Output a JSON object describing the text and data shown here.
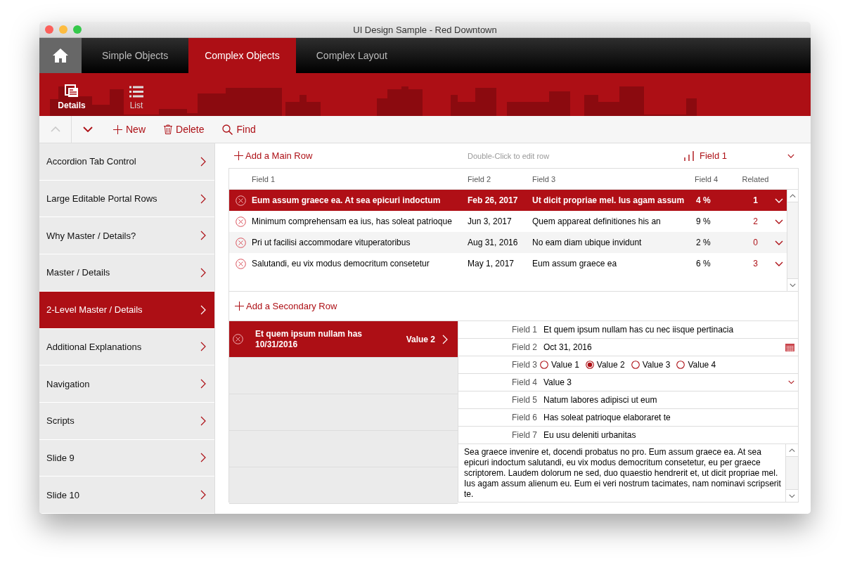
{
  "window": {
    "title": "UI Design Sample - Red Downtown"
  },
  "top_tabs": [
    {
      "label": "Simple Objects",
      "selected": false
    },
    {
      "label": "Complex Objects",
      "selected": true
    },
    {
      "label": "Complex Layout",
      "selected": false
    }
  ],
  "layouts": [
    {
      "label": "Details",
      "selected": true
    },
    {
      "label": "List",
      "selected": false
    }
  ],
  "toolbar": [
    {
      "kind": "up",
      "disabled": true
    },
    {
      "kind": "down",
      "disabled": false
    },
    {
      "kind": "new",
      "label": "New"
    },
    {
      "kind": "delete",
      "label": "Delete"
    },
    {
      "kind": "find",
      "label": "Find"
    }
  ],
  "sidebar": {
    "items": [
      {
        "label": "Accordion Tab Control",
        "selected": false
      },
      {
        "label": "Large Editable Portal Rows",
        "selected": false
      },
      {
        "label": "Why Master / Details?",
        "selected": false
      },
      {
        "label": "Master / Details",
        "selected": false
      },
      {
        "label": "2-Level Master / Details",
        "selected": true
      },
      {
        "label": "Additional Explanations",
        "selected": false
      },
      {
        "label": "Navigation",
        "selected": false
      },
      {
        "label": "Scripts",
        "selected": false
      },
      {
        "label": "Slide 9",
        "selected": false
      },
      {
        "label": "Slide 10",
        "selected": false
      }
    ]
  },
  "main_portal": {
    "add_label": "Add a Main Row",
    "hint": "Double-Click to edit row",
    "sort_field": "Field 1",
    "columns": [
      "Field 1",
      "Field 2",
      "Field 3",
      "Field 4",
      "Related"
    ],
    "rows": [
      {
        "field_1": "Eum assum graece ea. At sea epicuri indoctum",
        "field_2": "Feb 26, 2017",
        "field_3": "Ut dicit propriae mel. Ius agam assum",
        "field_4": "4 %",
        "related": "1",
        "selected": true
      },
      {
        "field_1": "Minimum comprehensam ea ius, has soleat patrioque",
        "field_2": "Jun 3, 2017",
        "field_3": "Quem appareat definitiones his an",
        "field_4": "9 %",
        "related": "2",
        "selected": false
      },
      {
        "field_1": "Pri ut facilisi accommodare vituperatoribus",
        "field_2": "Aug 31, 2016",
        "field_3": "No eam diam ubique invidunt",
        "field_4": "2 %",
        "related": "0",
        "selected": false
      },
      {
        "field_1": "Salutandi, eu vix modus democritum consetetur",
        "field_2": "May 1, 2017",
        "field_3": "Eum assum graece ea",
        "field_4": "6 %",
        "related": "3",
        "selected": false
      }
    ]
  },
  "secondary_portal": {
    "add_label": "Add a Secondary Row",
    "rows": [
      {
        "title": "Et quem ipsum nullam has",
        "date": "10/31/2016",
        "value": "Value 2",
        "selected": true
      }
    ]
  },
  "details": {
    "fields": [
      {
        "label": "Field 1",
        "kind": "text",
        "value": "Et quem ipsum nullam has cu nec iisque pertinacia"
      },
      {
        "label": "Field 2",
        "kind": "date",
        "value": "Oct 31, 2016"
      },
      {
        "label": "Field 3",
        "kind": "radio",
        "options": [
          {
            "label": "Value 1",
            "selected": false
          },
          {
            "label": "Value 2",
            "selected": true
          },
          {
            "label": "Value 3",
            "selected": false
          },
          {
            "label": "Value 4",
            "selected": false
          }
        ]
      },
      {
        "label": "Field 4",
        "kind": "dropdown",
        "value": "Value 3"
      },
      {
        "label": "Field 5",
        "kind": "text",
        "value": "Natum labores adipisci ut eum"
      },
      {
        "label": "Field 6",
        "kind": "text",
        "value": "Has soleat patrioque elaboraret te"
      },
      {
        "label": "Field 7",
        "kind": "text",
        "value": "Eu usu deleniti urbanitas"
      }
    ],
    "notes": "Sea graece invenire et, docendi probatus no pro. Eum assum graece ea. At sea epicuri indoctum salutandi, eu vix modus democritum consetetur, eu per graece scriptorem. Laudem dolorum ne sed, duo quaestio hendrerit et, ut dicit propriae mel. Ius agam assum alienum eu. Eum ei veri nostrum tacimates, nam nominavi scripserit te."
  }
}
